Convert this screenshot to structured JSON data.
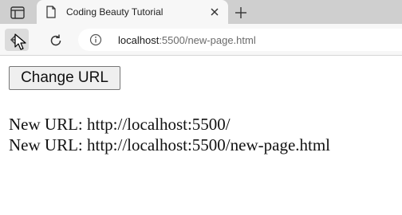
{
  "browser": {
    "tab": {
      "title": "Coding Beauty Tutorial"
    },
    "address": {
      "host": "localhost",
      "rest": ":5500/new-page.html"
    }
  },
  "page": {
    "button_label": "Change URL",
    "log_lines": [
      "New URL: http://localhost:5500/",
      "New URL: http://localhost:5500/new-page.html"
    ]
  }
}
